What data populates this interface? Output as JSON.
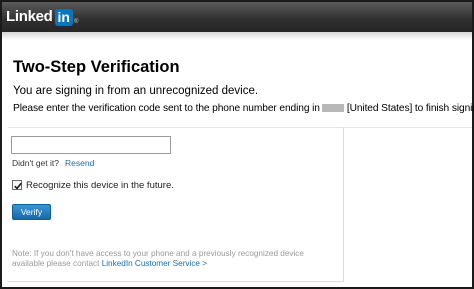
{
  "header": {
    "logo_text": "Linked",
    "logo_box": "in",
    "logo_reg": "®",
    "brand_color": "#0a76b8"
  },
  "page": {
    "title": "Two-Step Verification",
    "line1": "You are signing in from an unrecognized device.",
    "line2_prefix": "Please enter the verification code sent to the phone number ending in",
    "line2_suffix": "[United States] to finish signing in."
  },
  "form": {
    "code_value": "",
    "didnt_get": "Didn't get it?",
    "resend": "Resend",
    "recognize_label": "Recognize this device in the future.",
    "recognize_checked": true,
    "verify": "Verify"
  },
  "note": {
    "text": "Note: If you don't have access to your phone and a previously recognized device available please contact",
    "link": "LinkedIn Customer Service >"
  }
}
